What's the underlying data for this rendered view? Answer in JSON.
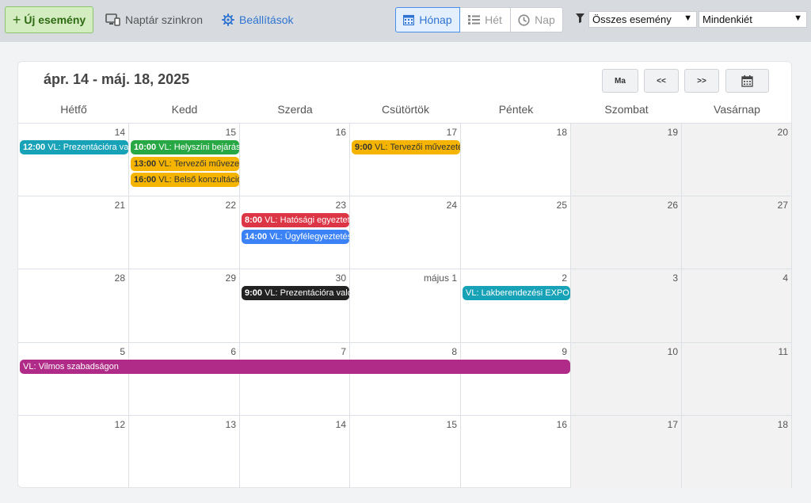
{
  "toolbar": {
    "new_event": "Új esemény",
    "sync": "Naptár szinkron",
    "settings": "Beállítások",
    "views": {
      "month": "Hónap",
      "week": "Hét",
      "day": "Nap"
    },
    "active_view": "month",
    "filter_events": "Összes esemény",
    "filter_people": "Mindenkiét"
  },
  "calendar": {
    "range_title": "ápr. 14 - máj. 18, 2025",
    "nav": {
      "today": "Ma",
      "prev": "<<",
      "next": ">>"
    },
    "weekdays": [
      "Hétfő",
      "Kedd",
      "Szerda",
      "Csütörtök",
      "Péntek",
      "Szombat",
      "Vasárnap"
    ],
    "weeks": [
      [
        "14",
        "15",
        "16",
        "17",
        "18",
        "19",
        "20"
      ],
      [
        "21",
        "22",
        "23",
        "24",
        "25",
        "26",
        "27"
      ],
      [
        "28",
        "29",
        "30",
        "május 1",
        "2",
        "3",
        "4"
      ],
      [
        "5",
        "6",
        "7",
        "8",
        "9",
        "10",
        "11"
      ],
      [
        "12",
        "13",
        "14",
        "15",
        "16",
        "17",
        "18"
      ]
    ],
    "events": [
      {
        "week": 0,
        "day": 0,
        "span": 1,
        "slot": 0,
        "time": "12:00",
        "title": "VL: Prezentációra való felkészülés",
        "color": "#17a2b8",
        "text": "#ffffff"
      },
      {
        "week": 0,
        "day": 1,
        "span": 1,
        "slot": 0,
        "time": "10:00",
        "title": "VL: Helyszíni bejárás - felmérés",
        "color": "#28a745",
        "text": "#ffffff"
      },
      {
        "week": 0,
        "day": 1,
        "span": 1,
        "slot": 1,
        "time": "13:00",
        "title": "VL: Tervezői művezetés",
        "color": "#f4b400",
        "text": "#333333"
      },
      {
        "week": 0,
        "day": 1,
        "span": 1,
        "slot": 2,
        "time": "16:00",
        "title": "VL: Belső konzultáció",
        "color": "#f4b400",
        "text": "#333333"
      },
      {
        "week": 0,
        "day": 3,
        "span": 1,
        "slot": 0,
        "time": "9:00",
        "title": "VL: Tervezői művezetés",
        "color": "#f4b400",
        "text": "#333333"
      },
      {
        "week": 1,
        "day": 2,
        "span": 1,
        "slot": 0,
        "time": "8:00",
        "title": "VL: Hatósági egyeztetés",
        "color": "#dc3545",
        "text": "#ffffff"
      },
      {
        "week": 1,
        "day": 2,
        "span": 1,
        "slot": 1,
        "time": "14:00",
        "title": "VL: Ügyfélegyeztetés",
        "color": "#3b82f6",
        "text": "#ffffff"
      },
      {
        "week": 2,
        "day": 2,
        "span": 1,
        "slot": 0,
        "time": "9:00",
        "title": "VL: Prezentációra való felkészülés",
        "color": "#222222",
        "text": "#ffffff"
      },
      {
        "week": 2,
        "day": 4,
        "span": 1,
        "slot": 0,
        "time": "",
        "title": "VL: Lakberendezési EXPO",
        "color": "#17a2b8",
        "text": "#ffffff"
      },
      {
        "week": 3,
        "day": 0,
        "span": 5,
        "slot": 0,
        "time": "",
        "title": "VL: Vilmos szabadságon",
        "color": "#b02a87",
        "text": "#ffffff"
      }
    ]
  }
}
